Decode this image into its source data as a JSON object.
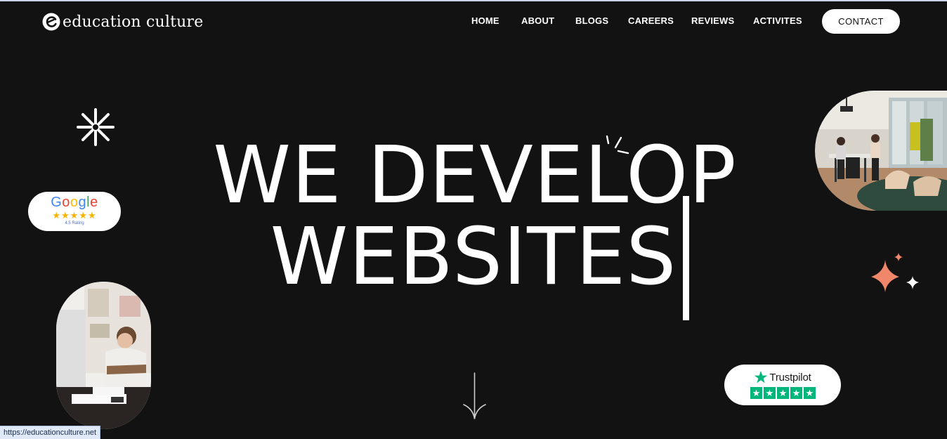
{
  "header": {
    "logo_text": "education culture",
    "nav": [
      {
        "label": "HOME"
      },
      {
        "label": "ABOUT"
      },
      {
        "label": "BLOGS"
      },
      {
        "label": "CAREERS"
      },
      {
        "label": "REVIEWS"
      },
      {
        "label": "ACTIVITES"
      }
    ],
    "contact_label": "CONTACT"
  },
  "hero": {
    "line1": "WE DEVELOP",
    "line2": "WEBSITES"
  },
  "badges": {
    "google": {
      "brand": "Google",
      "stars": "★★★★★",
      "rating_text": "4.5 Rating",
      "rating_value": 4.5
    },
    "trustpilot": {
      "brand": "Trustpilot",
      "star_count": 5
    }
  },
  "images": {
    "office_photo": "office-meeting-photo",
    "woman_photo": "woman-on-phone-at-desk-photo"
  },
  "status_bar": {
    "url": "https://educationculture.net"
  },
  "colors": {
    "background": "#121212",
    "accent_star": "#f0876a",
    "trustpilot_green": "#00b67a",
    "google_star": "#f4b400"
  }
}
